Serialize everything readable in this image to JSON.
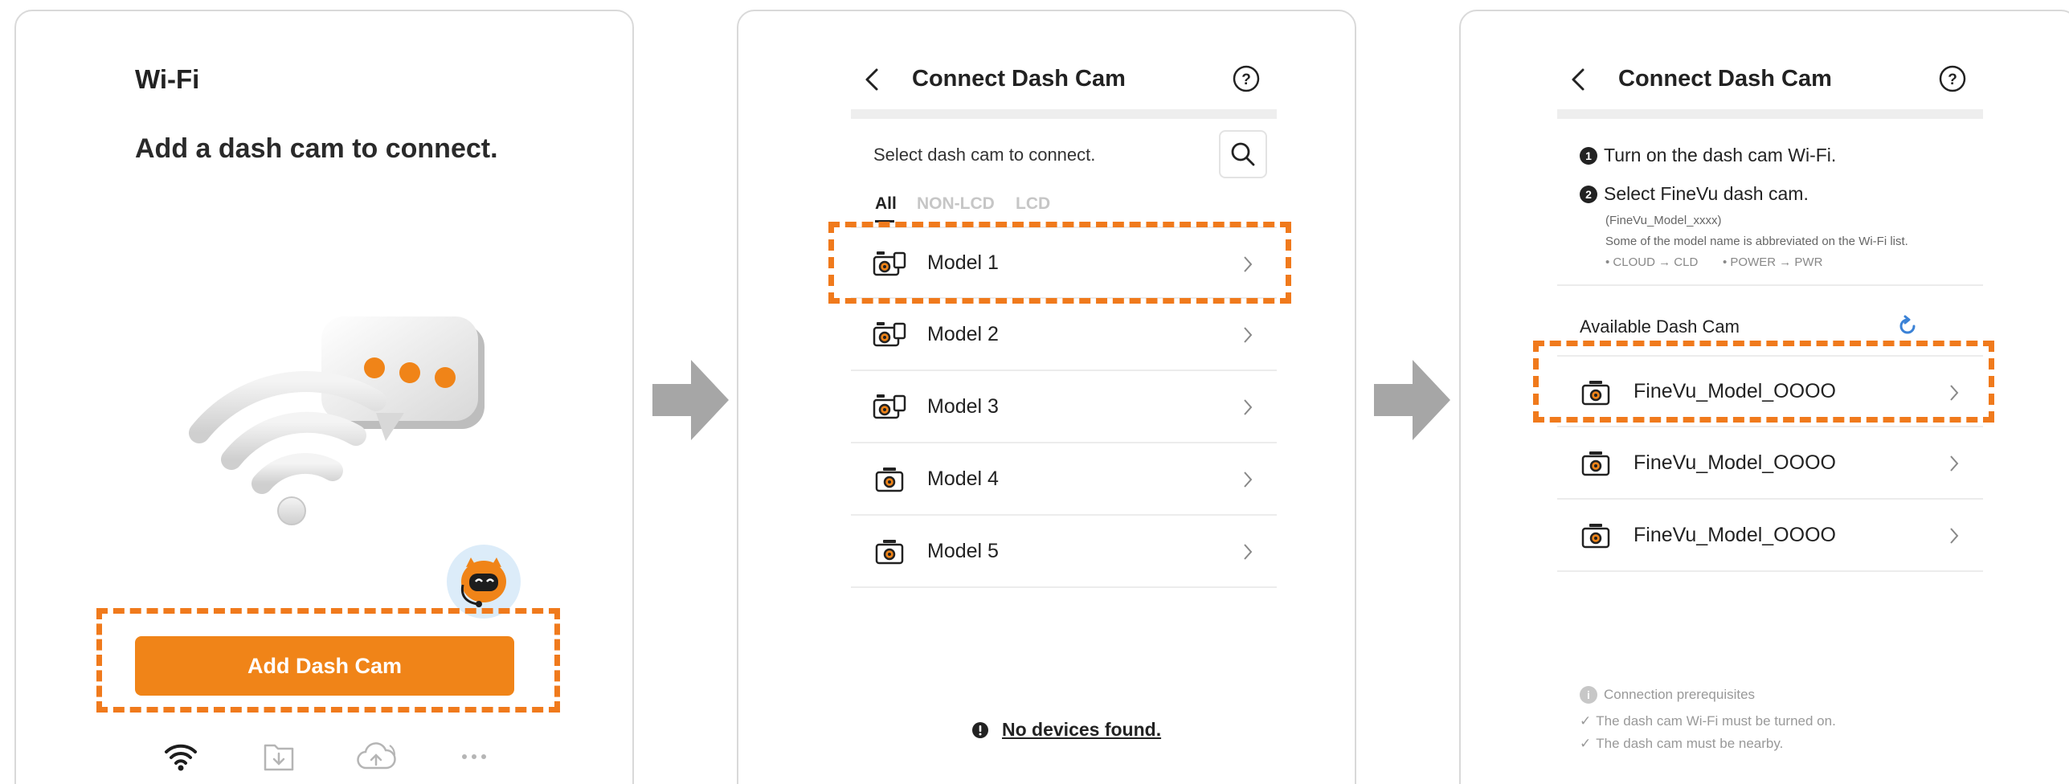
{
  "panel1": {
    "title": "Wi-Fi",
    "subtitle": "Add a dash cam to connect.",
    "add_button_label": "Add Dash Cam",
    "nav_icons": [
      "wifi-icon",
      "download-folder-icon",
      "cloud-upload-icon",
      "more-icon"
    ]
  },
  "panel2": {
    "header_title": "Connect Dash Cam",
    "select_prompt": "Select dash cam to connect.",
    "tabs": [
      {
        "label": "All",
        "active": true
      },
      {
        "label": "NON-LCD",
        "active": false
      },
      {
        "label": "LCD",
        "active": false
      }
    ],
    "models": [
      {
        "label": "Model 1",
        "icon": "lcd-dashcam-icon"
      },
      {
        "label": "Model 2",
        "icon": "lcd-dashcam-icon"
      },
      {
        "label": "Model 3",
        "icon": "lcd-dashcam-icon"
      },
      {
        "label": "Model 4",
        "icon": "dashcam-icon"
      },
      {
        "label": "Model 5",
        "icon": "dashcam-icon"
      }
    ],
    "no_devices": "No devices found."
  },
  "panel3": {
    "header_title": "Connect Dash Cam",
    "step1_num": "1",
    "step1": "Turn on the dash cam Wi-Fi.",
    "step2_num": "2",
    "step2": "Select FineVu dash cam.",
    "model_format": "(FineVu_Model_xxxx)",
    "abbrev_note": "Some of the model name is abbreviated on the Wi-Fi list.",
    "abbrev_cloud": "CLOUD → CLD",
    "abbrev_power": "POWER → PWR",
    "available_label": "Available Dash Cam",
    "devices": [
      {
        "label": "FineVu_Model_OOOO"
      },
      {
        "label": "FineVu_Model_OOOO"
      },
      {
        "label": "FineVu_Model_OOOO"
      }
    ],
    "prereq_title": "Connection prerequisites",
    "prereq_items": [
      "The dash cam Wi-Fi must be turned on.",
      "The dash cam must be nearby."
    ]
  },
  "colors": {
    "accent": "#f08418",
    "dash_highlight": "#f07a1c",
    "refresh_blue": "#3b82d6",
    "arrow_gray": "#a6a6a6"
  }
}
